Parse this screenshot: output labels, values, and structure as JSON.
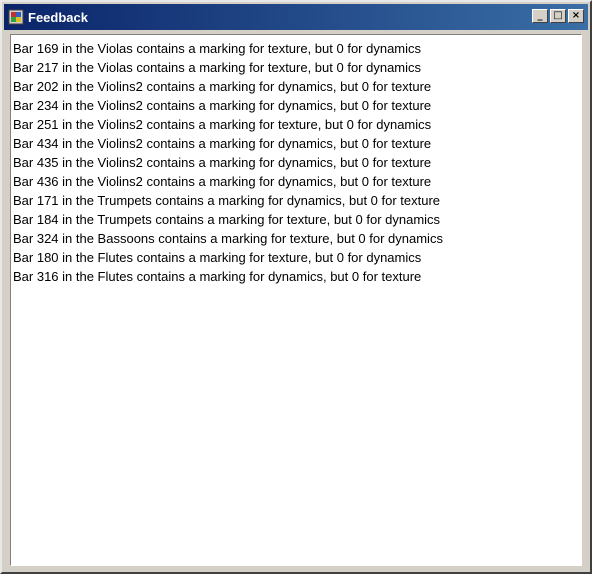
{
  "window": {
    "title": "Feedback",
    "buttons": {
      "minimize": "_",
      "maximize": "□",
      "close": "×"
    }
  },
  "messages": [
    "Bar 169 in the Violas contains a marking for texture, but 0 for dynamics",
    "Bar 217 in the Violas contains a marking for texture, but 0 for dynamics",
    "Bar 202 in the Violins2 contains a marking for dynamics, but 0 for texture",
    "Bar 234 in the Violins2 contains a marking for dynamics, but 0 for texture",
    "Bar 251 in the Violins2 contains a marking for texture, but 0 for dynamics",
    "Bar 434 in the Violins2 contains a marking for dynamics, but 0 for texture",
    "Bar 435 in the Violins2 contains a marking for dynamics, but 0 for texture",
    "Bar 436 in the Violins2 contains a marking for dynamics, but 0 for texture",
    "Bar 171 in the Trumpets contains a marking for dynamics, but 0 for texture",
    "Bar 184 in the Trumpets contains a marking for texture, but 0 for dynamics",
    "Bar 324 in the Bassoons contains a marking for texture, but 0 for dynamics",
    "Bar 180 in the Flutes contains a marking for texture, but 0 for dynamics",
    "Bar 316 in the Flutes contains a marking for dynamics, but 0 for texture"
  ]
}
